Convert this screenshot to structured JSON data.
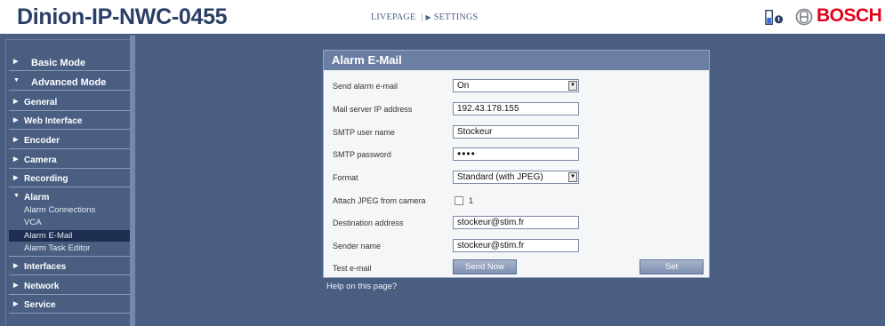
{
  "header": {
    "title": "Dinion-IP-NWC-0455",
    "nav_livepage": "LIVEPAGE",
    "nav_separator": "|",
    "nav_settings": "SETTINGS",
    "brand": "BOSCH"
  },
  "colors": {
    "brand_red": "#e2001a",
    "page_bg": "#4a5e82",
    "panel_head": "#6b7fa5",
    "title_blue": "#2b3f66"
  },
  "icons": [
    "triangle-right-icon",
    "triangle-down-icon",
    "status-icon",
    "bosch-armature-logo",
    "select-arrow-icon"
  ],
  "sidebar": {
    "basic_mode": "Basic Mode",
    "advanced_mode": "Advanced Mode",
    "items": [
      "General",
      "Web Interface",
      "Encoder",
      "Camera",
      "Recording",
      "Alarm"
    ],
    "alarm_subitems": [
      "Alarm Connections",
      "VCA",
      "Alarm E-Mail",
      "Alarm Task Editor"
    ],
    "items_after": [
      "Interfaces",
      "Network",
      "Service"
    ],
    "active_item": "Alarm E-Mail"
  },
  "panel": {
    "title": "Alarm E-Mail",
    "send_alarm_label": "Send alarm e-mail",
    "send_alarm_value": "On",
    "server_label": "Mail server IP address",
    "server_value": "192.43.178.155",
    "smtp_user_label": "SMTP user name",
    "smtp_user_value": "Stockeur",
    "smtp_pw_label": "SMTP password",
    "smtp_pw_value": "••••",
    "format_label": "Format",
    "format_value": "Standard (with JPEG)",
    "attach_label": "Attach JPEG from camera",
    "attach_option": "1",
    "attach_checked": false,
    "dest_label": "Destination address",
    "dest_value": "stockeur@stim.fr",
    "sender_label": "Sender name",
    "sender_value": "stockeur@stim.fr",
    "test_label": "Test e-mail",
    "send_now_button": "Send Now",
    "set_button": "Set"
  },
  "help_link": "Help on this page?"
}
